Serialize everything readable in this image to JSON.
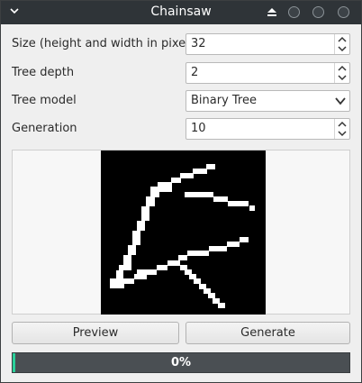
{
  "window": {
    "title": "Chainsaw"
  },
  "form": {
    "size_label": "Size (height and width in pixels)",
    "size_value": "32",
    "depth_label": "Tree depth",
    "depth_value": "2",
    "model_label": "Tree model",
    "model_value": "Binary Tree",
    "generation_label": "Generation",
    "generation_value": "10"
  },
  "buttons": {
    "preview": "Preview",
    "generate": "Generate"
  },
  "progress": {
    "value": 0,
    "text": "0%"
  },
  "colors": {
    "titlebar": "#2f3438",
    "progress_track": "#4a4f53",
    "progress_accent": "#2ad19a",
    "canvas_bg": "#000000",
    "pixels": "#ffffff"
  },
  "icons": [
    "chevron-down-icon",
    "shade-up-icon",
    "minimize-dot-icon",
    "maximize-dot-icon",
    "close-dot-icon",
    "spin-up-icon",
    "spin-down-icon",
    "dropdown-chevron-icon"
  ]
}
